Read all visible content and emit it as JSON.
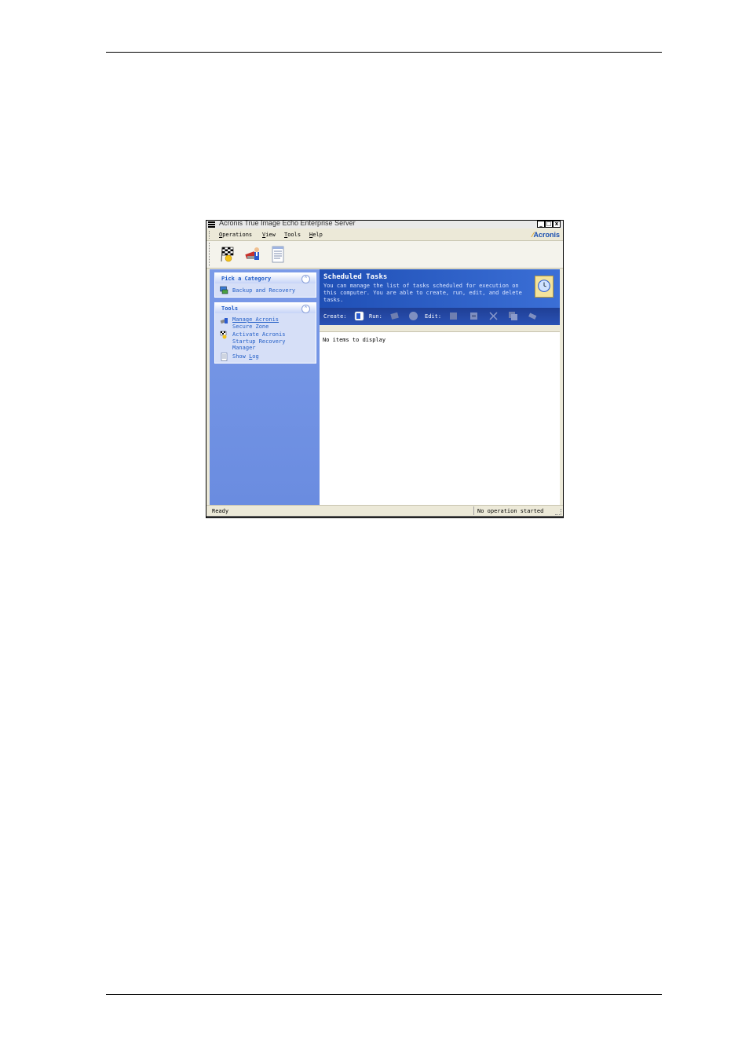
{
  "window": {
    "title": "Acronis True Image Echo Enterprise Server",
    "controls": {
      "minimize": "_",
      "maximize": "□",
      "close": "x"
    }
  },
  "menubar": {
    "items": [
      {
        "label": "Operations",
        "accel": "O",
        "rest": "perations"
      },
      {
        "label": "View",
        "accel": "V",
        "rest": "iew"
      },
      {
        "label": "Tools",
        "accel": "T",
        "rest": "ools"
      },
      {
        "label": "Help",
        "accel": "H",
        "rest": "elp"
      }
    ],
    "logo": "Acronis"
  },
  "toolbar": {
    "icons": [
      "checkered-flag-icon",
      "manager-tools-icon",
      "log-document-icon"
    ]
  },
  "sidebar": {
    "panels": [
      {
        "title": "Pick a Category",
        "items": [
          {
            "label": "Backup and Recovery",
            "icon": "backup-recovery-icon"
          }
        ]
      },
      {
        "title": "Tools",
        "items": [
          {
            "line1": "Manage Acronis",
            "line2": "Secure Zone",
            "icon": "secure-zone-icon"
          },
          {
            "line1": "Activate Acronis",
            "line2": "Startup Recovery",
            "line3": "Manager",
            "icon": "recovery-manager-icon"
          },
          {
            "label_pre": "Show ",
            "accel": "L",
            "label_post": "og",
            "icon": "show-log-icon"
          }
        ]
      }
    ]
  },
  "main": {
    "title": "Scheduled Tasks",
    "description": "You can manage the list of tasks scheduled for execution on this computer. You are able to create, run, edit, and delete tasks.",
    "actions": {
      "create_label": "Create:",
      "run_label": "Run:",
      "edit_label": "Edit:"
    },
    "empty_text": "No items to display"
  },
  "status": {
    "left": "Ready",
    "right": "No operation started"
  },
  "colors": {
    "accent_blue": "#215dc6",
    "banner_blue": "#1f4fb5",
    "sidebar_blue": "#7a9ae8"
  }
}
